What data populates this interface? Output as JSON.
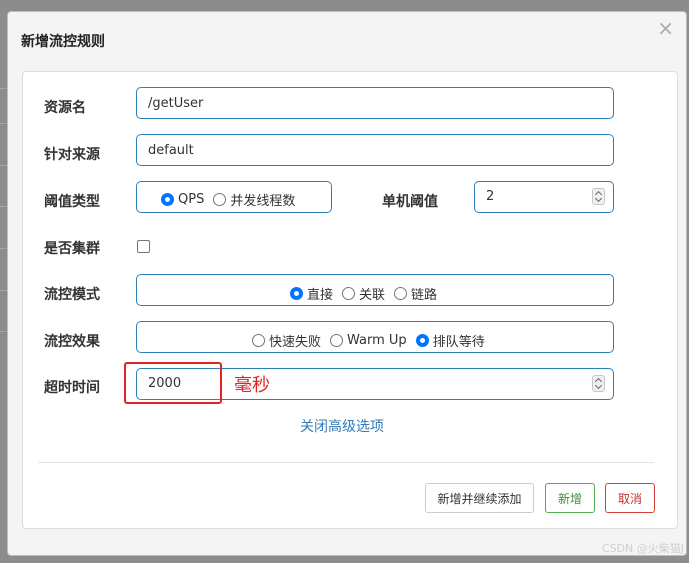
{
  "modal": {
    "title": "新增流控规则",
    "close": "×"
  },
  "form": {
    "resource_name": {
      "label": "资源名",
      "value": "/getUser"
    },
    "source": {
      "label": "针对来源",
      "value": "default"
    },
    "threshold_type": {
      "label": "阈值类型",
      "options": [
        {
          "label": "QPS",
          "selected": true
        },
        {
          "label": "并发线程数",
          "selected": false
        }
      ]
    },
    "single_threshold": {
      "label": "单机阈值",
      "value": "2"
    },
    "cluster": {
      "label": "是否集群",
      "checked": false
    },
    "flow_mode": {
      "label": "流控模式",
      "options": [
        {
          "label": "直接",
          "selected": true
        },
        {
          "label": "关联",
          "selected": false
        },
        {
          "label": "链路",
          "selected": false
        }
      ]
    },
    "flow_effect": {
      "label": "流控效果",
      "options": [
        {
          "label": "快速失败",
          "selected": false
        },
        {
          "label": "Warm Up",
          "selected": false
        },
        {
          "label": "排队等待",
          "selected": true
        }
      ]
    },
    "timeout": {
      "label": "超时时间",
      "value": "2000"
    },
    "annotation": "毫秒",
    "advanced_link": "关闭高级选项"
  },
  "buttons": {
    "add_continue": "新增并继续添加",
    "add": "新增",
    "cancel": "取消"
  },
  "watermark": "CSDN @火柴猫J"
}
